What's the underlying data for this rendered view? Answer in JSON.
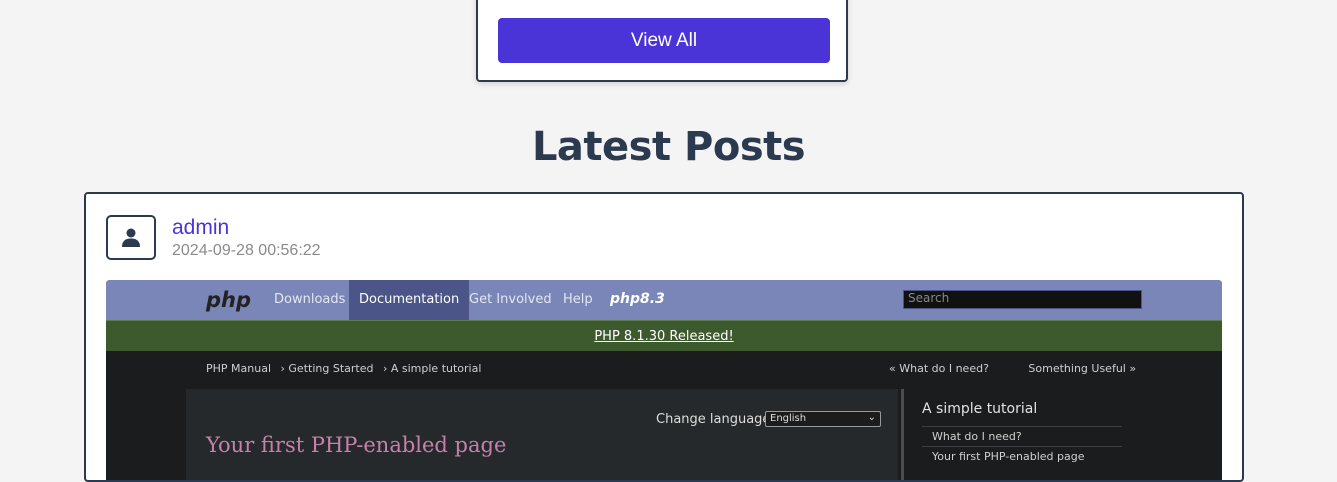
{
  "top_card": {
    "view_all_label": "View All"
  },
  "section_title": "Latest Posts",
  "post": {
    "author": "admin",
    "date": "2024-09-28 00:56:22",
    "screenshot": {
      "logo": "php",
      "nav": [
        "Downloads",
        "Documentation",
        "Get Involved",
        "Help"
      ],
      "active_nav": "Documentation",
      "version_logo": "php8.3",
      "search_placeholder": "Search",
      "release_text": "PHP 8.1.30 Released!",
      "breadcrumbs": [
        "PHP Manual",
        "› Getting Started",
        "› A simple tutorial"
      ],
      "prev_link": "« What do I need?",
      "next_link": "Something Useful »",
      "change_language_label": "Change language:",
      "language_value": "English",
      "page_heading": "Your first PHP-enabled page",
      "sidebar_title": "A simple tutorial",
      "sidebar_items": [
        "What do I need?",
        "Your first PHP-enabled page"
      ]
    }
  },
  "icons": {
    "avatar": "user-icon",
    "select": "chevron-down-icon"
  },
  "colors": {
    "accent": "#4a34d8",
    "heading": "#2b3a4e",
    "php_nav": "#7a86b8",
    "php_release_bar": "#3d5a2e"
  }
}
